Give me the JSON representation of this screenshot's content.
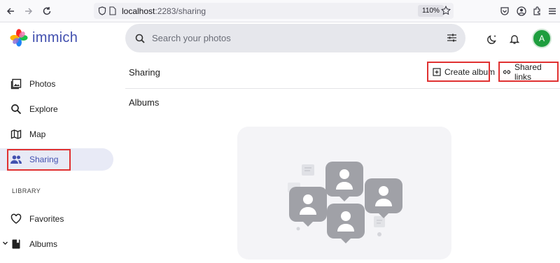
{
  "browser": {
    "url_host": "localhost",
    "url_rest": ":2283/sharing",
    "zoom": "110%"
  },
  "app": {
    "name": "immich",
    "search_placeholder": "Search your photos",
    "avatar_initial": "A",
    "avatar_color": "#1e9e3e",
    "accent": "#4250af"
  },
  "sidebar": {
    "items": [
      {
        "label": "Photos",
        "icon": "photos-icon"
      },
      {
        "label": "Explore",
        "icon": "search-icon"
      },
      {
        "label": "Map",
        "icon": "map-icon"
      },
      {
        "label": "Sharing",
        "icon": "people-icon",
        "active": true
      }
    ],
    "library_heading": "LIBRARY",
    "library_items": [
      {
        "label": "Favorites",
        "icon": "heart-icon"
      },
      {
        "label": "Albums",
        "icon": "album-icon"
      }
    ]
  },
  "main": {
    "title": "Sharing",
    "create_album": "Create album",
    "shared_links": "Shared links",
    "albums_heading": "Albums"
  }
}
